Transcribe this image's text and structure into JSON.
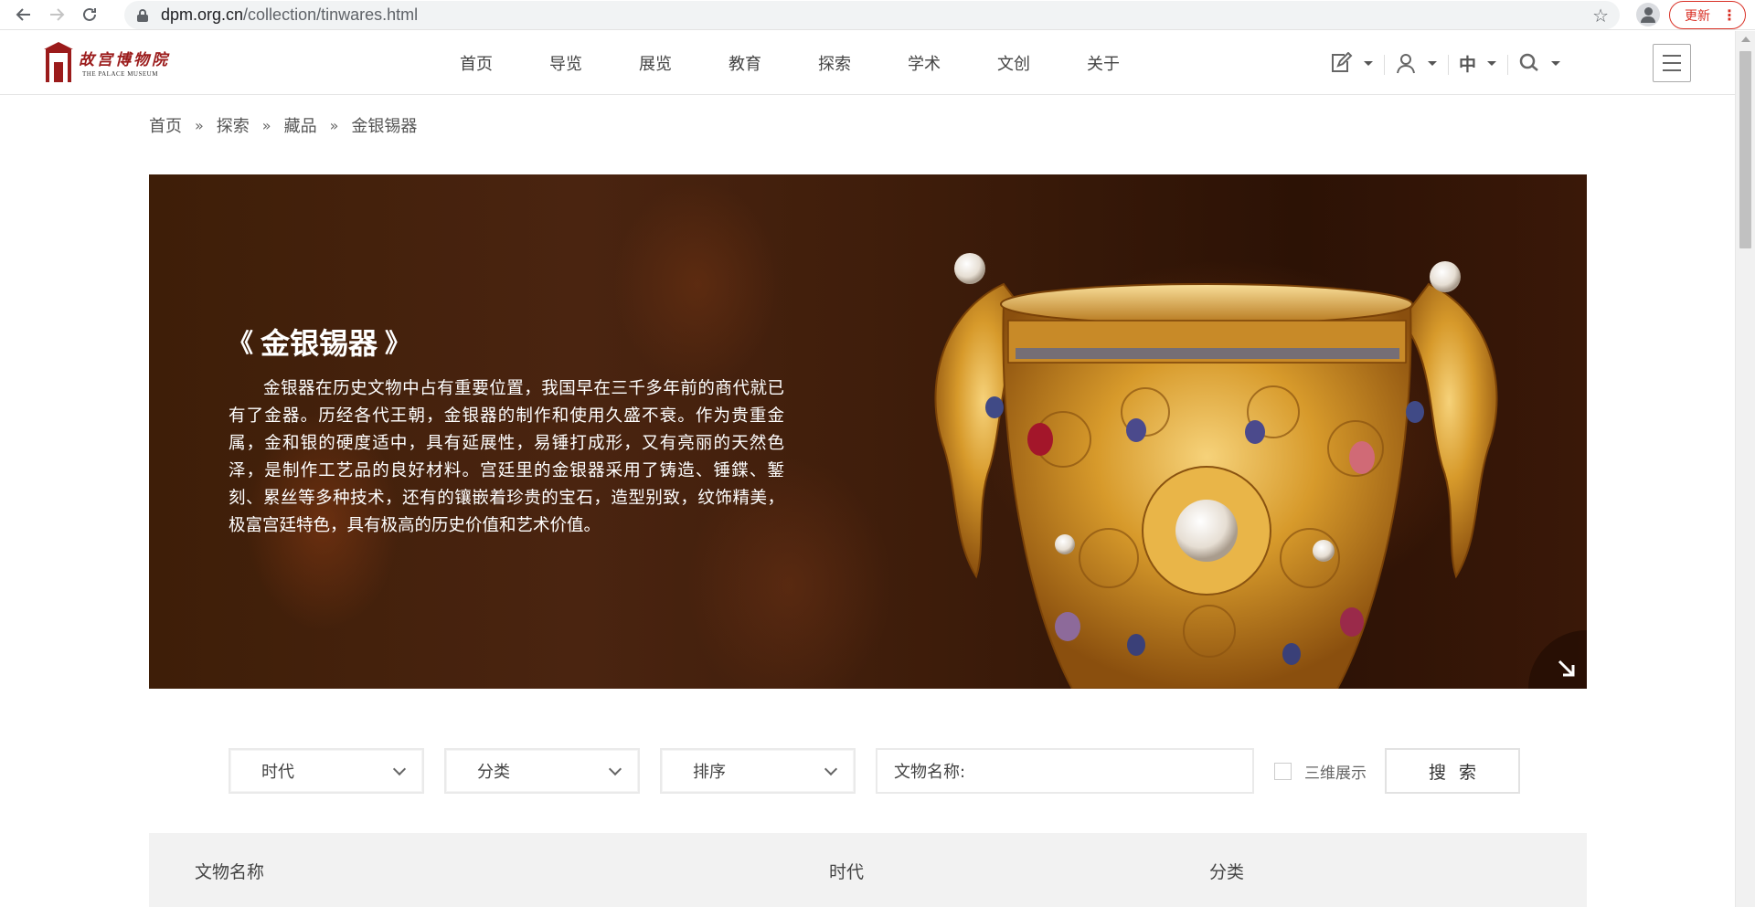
{
  "browser": {
    "url_domain": "dpm.org.cn",
    "url_path": "/collection/tinwares.html",
    "update_label": "更新"
  },
  "site": {
    "logo_cn": "故宫博物院",
    "logo_en": "THE PALACE MUSEUM",
    "nav": [
      "首页",
      "导览",
      "展览",
      "教育",
      "探索",
      "学术",
      "文创",
      "关于"
    ],
    "lang_label": "中"
  },
  "breadcrumb": {
    "items": [
      "首页",
      "探索",
      "藏品",
      "金银锡器"
    ],
    "separator": "»"
  },
  "banner": {
    "title": "金银锡器",
    "bracket_left": "《",
    "bracket_right": "》",
    "description": "金银器在历史文物中占有重要位置，我国早在三千多年前的商代就已有了金器。历经各代王朝，金银器的制作和使用久盛不衰。作为贵重金属，金和银的硬度适中，具有延展性，易锤打成形，又有亮丽的天然色泽，是制作工艺品的良好材料。宫廷里的金银器采用了铸造、锤鍱、錾刻、累丝等多种技术，还有的镶嵌着珍贵的宝石，造型别致，纹饰精美，极富宫廷特色，具有极高的历史价值和艺术价值。"
  },
  "filters": {
    "era_label": "时代",
    "category_label": "分类",
    "sort_label": "排序",
    "name_placeholder": "文物名称:",
    "show3d_label": "三维展示",
    "search_label": "搜索"
  },
  "table": {
    "columns": [
      "文物名称",
      "时代",
      "分类"
    ]
  },
  "colors": {
    "brand_red": "#9b1b1b",
    "banner_brown": "#3e1e08"
  }
}
